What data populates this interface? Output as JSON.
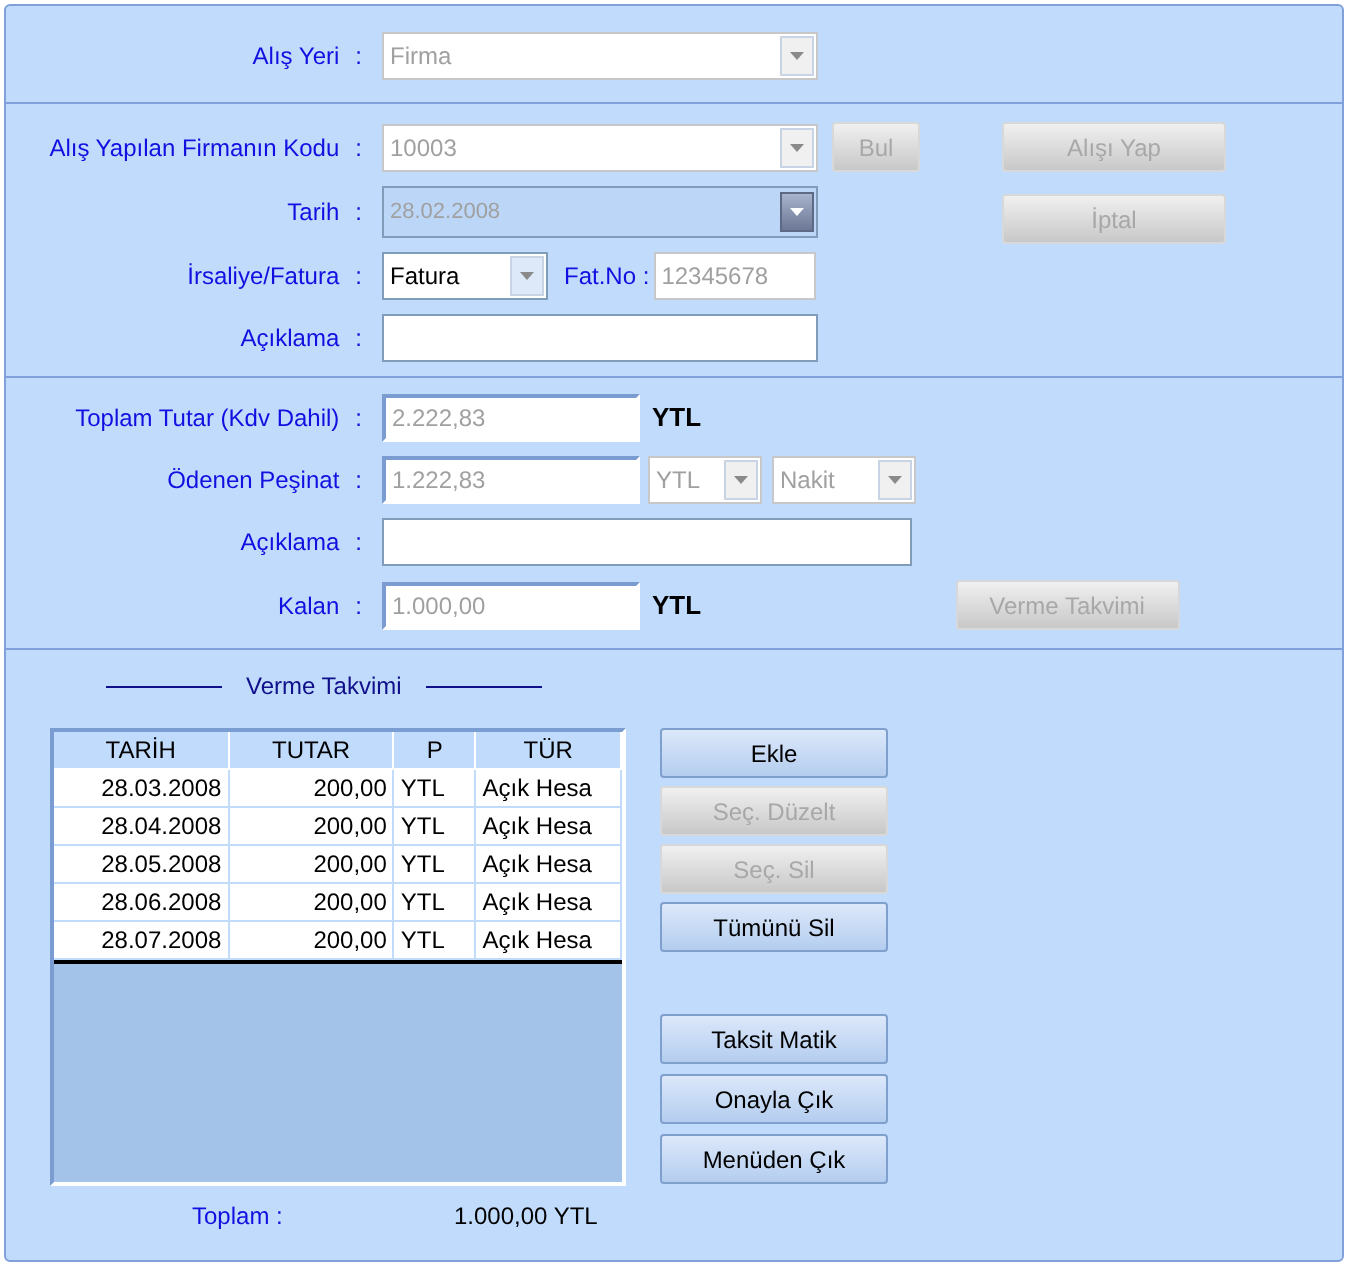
{
  "purchase_place": {
    "label": "Alış Yeri",
    "colon": ":",
    "value": "Firma",
    "disabled": true
  },
  "firm_code": {
    "label": "Alış Yapılan Firmanın Kodu",
    "colon": ":",
    "value": "10003",
    "disabled": true
  },
  "find_button": {
    "label": "Bul",
    "disabled": true
  },
  "purchase_button": {
    "label": "Alışı Yap",
    "disabled": true
  },
  "cancel_button": {
    "label": "İptal",
    "disabled": true
  },
  "date": {
    "label": "Tarih",
    "colon": ":",
    "value": "28.02.2008",
    "disabled": true
  },
  "doc_type": {
    "label": "İrsaliye/Fatura",
    "colon": ":",
    "value": "Fatura",
    "disabled": false
  },
  "invoice_no": {
    "label": "Fat.No :",
    "value": "12345678",
    "disabled": true
  },
  "description": {
    "label": "Açıklama",
    "colon": ":",
    "disabled": false
  },
  "total": {
    "label": "Toplam Tutar (Kdv Dahil)",
    "colon": ":",
    "value": "2.222,83",
    "unit": "YTL",
    "disabled": true
  },
  "down_payment": {
    "label": "Ödenen Peşinat",
    "colon": ":",
    "value": "1.222,83",
    "currency": "YTL",
    "method": "Nakit",
    "disabled": true
  },
  "payment_note": {
    "label": "Açıklama",
    "colon": ":",
    "disabled": false
  },
  "remaining": {
    "label": "Kalan",
    "colon": ":",
    "value": "1.000,00",
    "unit": "YTL",
    "disabled": true
  },
  "schedule_button": {
    "label": "Verme Takvimi",
    "disabled": true
  },
  "schedule": {
    "title": "Verme Takvimi",
    "columns": [
      "TARİH",
      "TUTAR",
      "P",
      "TÜR"
    ],
    "rows": [
      [
        "28.03.2008",
        "200,00",
        "YTL",
        "Açık Hesa"
      ],
      [
        "28.04.2008",
        "200,00",
        "YTL",
        "Açık Hesa"
      ],
      [
        "28.05.2008",
        "200,00",
        "YTL",
        "Açık Hesa"
      ],
      [
        "28.06.2008",
        "200,00",
        "YTL",
        "Açık Hesa"
      ],
      [
        "28.07.2008",
        "200,00",
        "YTL",
        "Açık Hesa"
      ]
    ],
    "total_label": "Toplam :",
    "total_value": "1.000,00 YTL"
  },
  "row_actions": [
    {
      "label": "Ekle",
      "disabled": false
    },
    {
      "label": "Seç. Düzelt",
      "disabled": true
    },
    {
      "label": "Seç. Sil",
      "disabled": true
    },
    {
      "label": "Tümünü Sil",
      "disabled": false
    }
  ],
  "form_actions": [
    {
      "label": "Taksit Matik",
      "disabled": false
    },
    {
      "label": "Onayla Çık",
      "disabled": false
    },
    {
      "label": "Menüden Çık",
      "disabled": false
    }
  ]
}
